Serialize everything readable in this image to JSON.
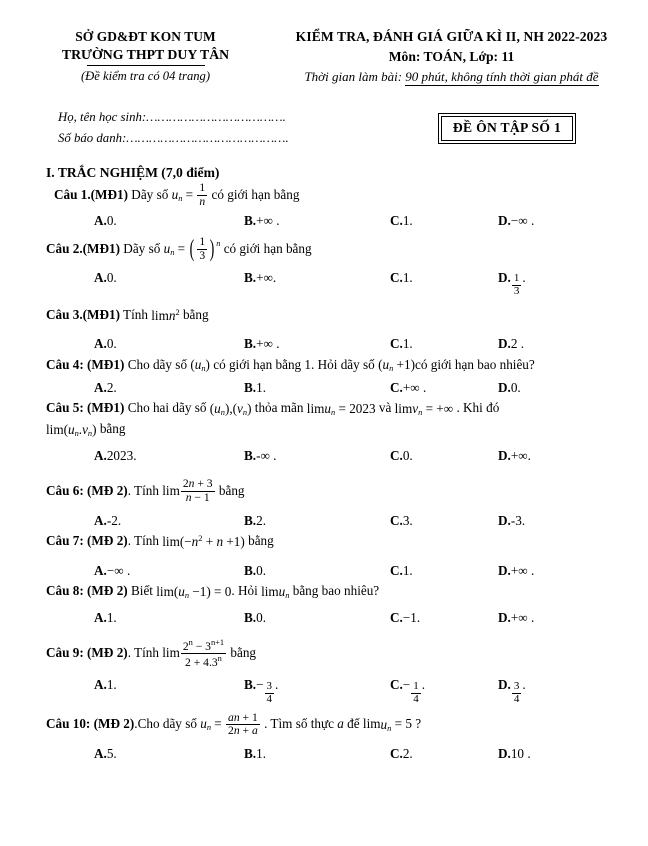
{
  "header": {
    "department": "SỞ GD&ĐT KON TUM",
    "school": "TRƯỜNG THPT DUY TÂN",
    "pages_note": "(Đề kiểm tra có 04 trang)",
    "exam_title": "KIỂM TRA, ĐÁNH GIÁ GIỮA KÌ II, NH 2022-2023",
    "subject_line": "Môn: TOÁN,  Lớp: 11",
    "time_prefix": "Thời gian làm bài: ",
    "time_underlined": "90 phút, không tính thời gian phát đề"
  },
  "student_info": {
    "name_line": "Họ, tên học sinh:……………………………….",
    "id_line": "Số báo danh:…………………………………….",
    "exam_code": "ĐỀ ÔN TẬP SỐ 1"
  },
  "section": {
    "heading": "I. TRẮC NGHIỆM (7,0 điểm)"
  },
  "questions": [
    {
      "label": "Câu 1.(MĐ1)",
      "stem_before": " Dãy số ",
      "stem_after": " có giới hạn bằng",
      "options": [
        {
          "key": "A.",
          "text": " 0."
        },
        {
          "key": "B.",
          "text": " +∞ ."
        },
        {
          "key": "C.",
          "text": " 1."
        },
        {
          "key": "D.",
          "text": " −∞ ."
        }
      ]
    },
    {
      "label": "Câu 2.(MĐ1)",
      "stem_before": " Dãy số ",
      "stem_after": " có giới hạn bằng",
      "options": [
        {
          "key": "A.",
          "text": " 0."
        },
        {
          "key": "B.",
          "text": " +∞."
        },
        {
          "key": "C.",
          "text": "1."
        },
        {
          "key": "D.",
          "text": ""
        }
      ]
    },
    {
      "label": "Câu 3.(MĐ1)",
      "stem_before": " Tính ",
      "stem_after": "  bằng",
      "options": [
        {
          "key": "A.",
          "text": " 0."
        },
        {
          "key": "B.",
          "text": "+∞ ."
        },
        {
          "key": "C.",
          "text": "1."
        },
        {
          "key": "D.",
          "text": " 2 ."
        }
      ]
    },
    {
      "label": "Câu 4: (MĐ1)",
      "stem_before": " Cho dãy số ",
      "stem_mid": " có giới hạn bằng 1. Hỏi dãy số ",
      "stem_after": "có giới hạn bao nhiêu?",
      "options": [
        {
          "key": "A.",
          "text": "2."
        },
        {
          "key": "B.",
          "text": "1."
        },
        {
          "key": "C.",
          "text": "+∞ ."
        },
        {
          "key": "D.",
          "text": "0."
        }
      ]
    },
    {
      "label": "Câu 5: (MĐ1)",
      "stem_before": " Cho hai dãy số ",
      "stem_mid": " thỏa mãn ",
      "stem_after": " . Khi đó",
      "cont_after": " bằng",
      "options": [
        {
          "key": "A.",
          "text": "2023."
        },
        {
          "key": "B.",
          "text": "-∞ ."
        },
        {
          "key": "C.",
          "text": "0."
        },
        {
          "key": "D.",
          "text": " +∞."
        }
      ]
    },
    {
      "label": "Câu 6: (MĐ 2)",
      "stem_before": ". Tính  ",
      "stem_after": " bằng",
      "options": [
        {
          "key": "A.",
          "text": "-2."
        },
        {
          "key": "B.",
          "text": "2."
        },
        {
          "key": "C.",
          "text": "3."
        },
        {
          "key": "D.",
          "text": "-3."
        }
      ]
    },
    {
      "label": "Câu 7: (MĐ 2)",
      "stem_before": ". Tính  ",
      "stem_after": " bằng",
      "options": [
        {
          "key": "A.",
          "text": " −∞ ."
        },
        {
          "key": "B.",
          "text": "0."
        },
        {
          "key": "C.",
          "text": "1."
        },
        {
          "key": "D.",
          "text": " +∞ ."
        }
      ]
    },
    {
      "label": "Câu 8: (MĐ 2)",
      "stem_before": " Biết ",
      "stem_mid": ". Hỏi ",
      "stem_after": " bằng  bao nhiêu?",
      "options": [
        {
          "key": "A.",
          "text": "1."
        },
        {
          "key": "B.",
          "text": " 0."
        },
        {
          "key": "C.",
          "text": " −1."
        },
        {
          "key": "D.",
          "text": "+∞ ."
        }
      ]
    },
    {
      "label": "Câu 9: (MĐ 2)",
      "stem_before": ". Tính  ",
      "stem_after": "  bằng",
      "options": [
        {
          "key": "A.",
          "text": "1."
        },
        {
          "key": "B.",
          "text": "−"
        },
        {
          "key": "C.",
          "text": "−"
        },
        {
          "key": "D.",
          "text": ""
        }
      ]
    },
    {
      "label": "Câu 10: (MĐ 2)",
      "stem_before": ".Cho dãy số ",
      "stem_after": " . Tìm số thực ",
      "options": [
        {
          "key": "A.",
          "text": "5."
        },
        {
          "key": "B.",
          "text": "1."
        },
        {
          "key": "C.",
          "text": " 2."
        },
        {
          "key": "D.",
          "text": "10 ."
        }
      ]
    }
  ],
  "math": {
    "q1_un": "u",
    "q1_frac": {
      "num": "1",
      "den": "n"
    },
    "q2_frac": {
      "num": "1",
      "den": "3"
    },
    "q2_opt_d_frac": {
      "num": "1",
      "den": "3"
    },
    "q3_expr": "lim n²",
    "q6_frac": {
      "num": "2n + 3",
      "den": "n − 1"
    },
    "q7_expr": "lim(−n² + n + 1)",
    "q9_frac": {
      "num": "2ⁿ − 3ⁿ⁺¹",
      "den": "2 + 4.3ⁿ"
    },
    "q9_b_frac": {
      "num": "3",
      "den": "4"
    },
    "q9_c_frac": {
      "num": "1",
      "den": "4"
    },
    "q9_d_frac": {
      "num": "3",
      "den": "4"
    },
    "q10_frac": {
      "num": "an + 1",
      "den": "2n + a"
    },
    "q10_tail": " để lim",
    "q10_tail2": " = 5 ?",
    "q5_lim1": "lim u",
    "q5_val1": " = 2023",
    "q5_and": " và  ",
    "q5_lim2": "lim v",
    "q5_val2": " = +∞"
  }
}
